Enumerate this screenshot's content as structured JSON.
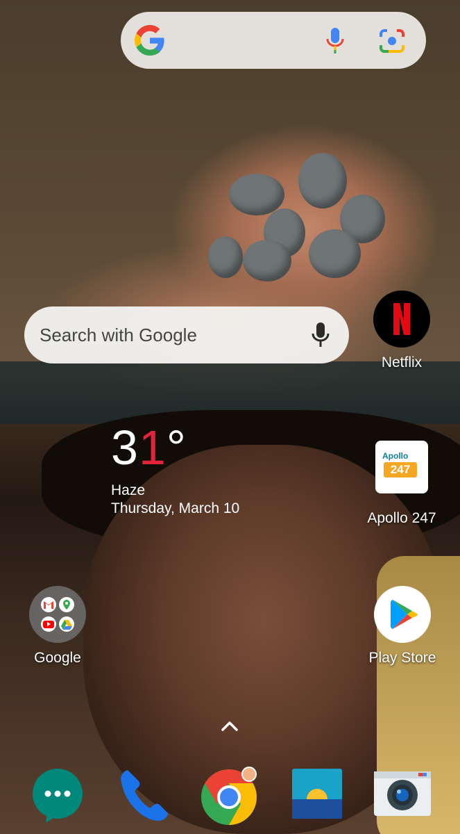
{
  "search_widget": {
    "placeholder": "Search with Google"
  },
  "weather": {
    "temp_main": "3",
    "temp_red": "1",
    "degree": "°",
    "condition": "Haze",
    "date": "Thursday, March 10"
  },
  "apps": {
    "netflix": "Netflix",
    "apollo": "Apollo 247",
    "apollo_icon_top": "Apollo",
    "apollo_icon_num": "247",
    "google_folder": "Google",
    "play_store": "Play Store"
  },
  "dock": [
    "Messages",
    "Phone",
    "Chrome",
    "Gallery",
    "Camera"
  ],
  "colors": {
    "netflix_red": "#e50914",
    "google_blue": "#4285f4",
    "google_red": "#ea4335",
    "google_yellow": "#fbbc05",
    "google_green": "#34a853"
  }
}
